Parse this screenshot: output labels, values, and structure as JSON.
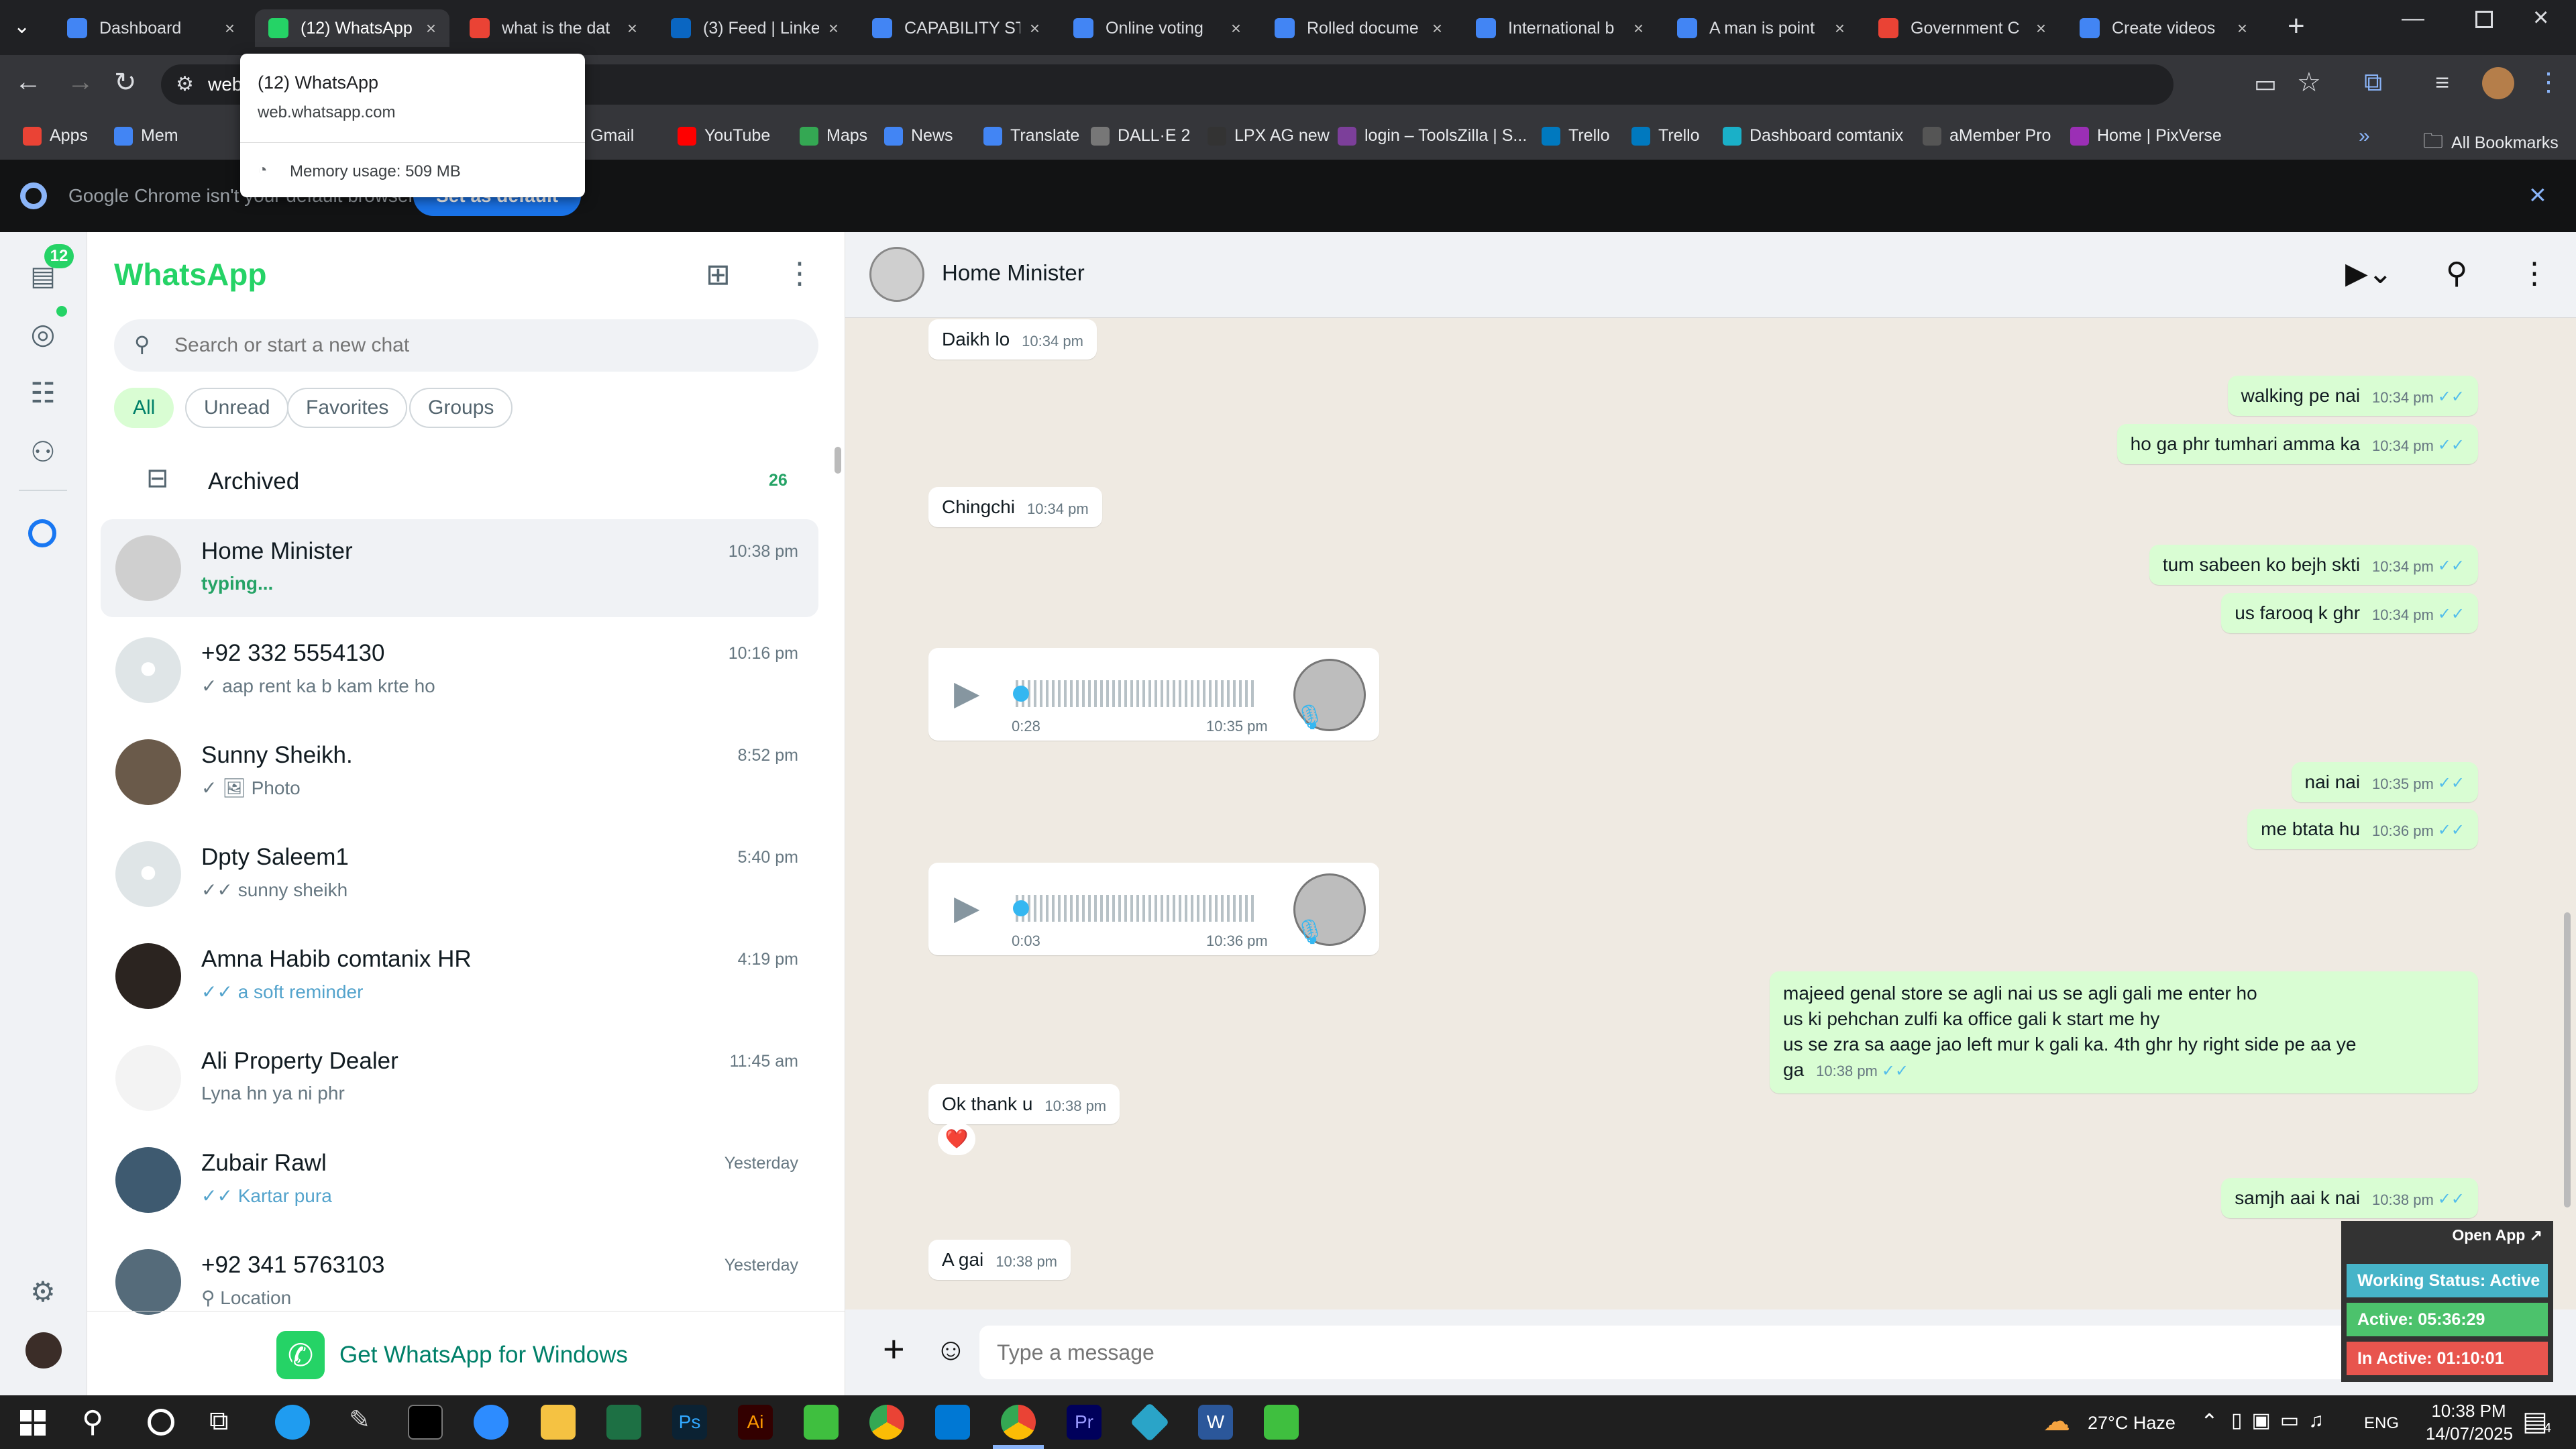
{
  "browser": {
    "tabs": [
      {
        "label": "Dashboard",
        "color": "#4285f4"
      },
      {
        "label": "(12) WhatsApp",
        "color": "#25d366",
        "active": true
      },
      {
        "label": "what is the dat",
        "color": "#ea4335"
      },
      {
        "label": "(3) Feed | Linke",
        "color": "#0a66c2"
      },
      {
        "label": "CAPABILITY ST",
        "color": "#4285f4"
      },
      {
        "label": "Online voting",
        "color": "#4285f4"
      },
      {
        "label": "Rolled docume",
        "color": "#4285f4"
      },
      {
        "label": "International b",
        "color": "#4285f4"
      },
      {
        "label": "A man is point",
        "color": "#4285f4"
      },
      {
        "label": "Government C",
        "color": "#ea4335"
      },
      {
        "label": "Create videos",
        "color": "#4285f4"
      }
    ],
    "address_text": "web",
    "bookmarks": [
      {
        "label": "Apps"
      },
      {
        "label": "Mem"
      },
      {
        "label": "Gmail"
      },
      {
        "label": "YouTube"
      },
      {
        "label": "Maps"
      },
      {
        "label": "News"
      },
      {
        "label": "Translate"
      },
      {
        "label": "DALL·E 2"
      },
      {
        "label": "LPX AG new"
      },
      {
        "label": "login – ToolsZilla | S..."
      },
      {
        "label": "Trello"
      },
      {
        "label": "Trello"
      },
      {
        "label": "Dashboard comtanix"
      },
      {
        "label": "aMember Pro"
      },
      {
        "label": "Home | PixVerse"
      }
    ],
    "all_bookmarks": "All Bookmarks",
    "infobar_text": "Google Chrome isn't your default browser",
    "infobar_button": "Set as default",
    "tooltip": {
      "title": "(12) WhatsApp",
      "url": "web.whatsapp.com",
      "memory": "Memory usage: 509 MB"
    }
  },
  "whatsapp": {
    "rail": {
      "unread_badge": "12"
    },
    "title": "WhatsApp",
    "search_placeholder": "Search or start a new chat",
    "filters": [
      "All",
      "Unread",
      "Favorites",
      "Groups"
    ],
    "archived": {
      "label": "Archived",
      "count": "26"
    },
    "chats": [
      {
        "name": "Home Minister",
        "time": "10:38 pm",
        "preview": "typing...",
        "typing": true
      },
      {
        "name": "+92 332 5554130",
        "time": "10:16 pm",
        "preview": "✓ aap rent ka b kam krte ho"
      },
      {
        "name": "Sunny Sheikh.",
        "time": "8:52 pm",
        "preview": "✓ 🖼 Photo"
      },
      {
        "name": "Dpty Saleem1",
        "time": "5:40 pm",
        "preview": "✓✓ sunny sheikh"
      },
      {
        "name": "Amna Habib comtanix HR",
        "time": "4:19 pm",
        "preview": "✓✓ a soft reminder",
        "blue": true
      },
      {
        "name": "Ali Property Dealer",
        "time": "11:45 am",
        "preview": "Lyna hn ya ni phr"
      },
      {
        "name": "Zubair Rawl",
        "time": "Yesterday",
        "preview": "✓✓ Kartar pura",
        "blue": true
      },
      {
        "name": "+92 341 5763103",
        "time": "Yesterday",
        "preview": "⚲ Location"
      }
    ],
    "get_app": "Get WhatsApp for Windows",
    "chat_header": {
      "name": "Home Minister"
    },
    "messages": {
      "m1": {
        "text": "Daikh lo",
        "time": "10:34 pm"
      },
      "m2": {
        "text": "walking pe nai",
        "time": "10:34 pm"
      },
      "m3": {
        "text": "ho ga phr tumhari amma ka",
        "time": "10:34 pm"
      },
      "m4": {
        "text": "Chingchi",
        "time": "10:34 pm"
      },
      "m5": {
        "text": "tum sabeen ko bejh skti",
        "time": "10:34 pm"
      },
      "m6": {
        "text": "us farooq k ghr",
        "time": "10:34 pm"
      },
      "v1": {
        "duration": "0:28",
        "time": "10:35 pm"
      },
      "m7": {
        "text": "nai nai",
        "time": "10:35 pm"
      },
      "m8": {
        "text": "me btata hu",
        "time": "10:36 pm"
      },
      "v2": {
        "duration": "0:03",
        "time": "10:36 pm"
      },
      "m9": {
        "line1": "majeed  genal store se agli nai us se agli gali me enter ho",
        "line2": "us ki pehchan zulfi ka office gali k start me hy",
        "line3": "us se zra sa aage jao left mur k gali ka. 4th ghr hy right side pe aa ye ga",
        "time": "10:38 pm"
      },
      "m10": {
        "text": "Ok thank u",
        "time": "10:38 pm",
        "reaction": "❤️"
      },
      "m11": {
        "text": "samjh aai k nai",
        "time": "10:38 pm"
      },
      "m12": {
        "text": "A gai",
        "time": "10:38 pm"
      }
    },
    "composer_placeholder": "Type a message"
  },
  "widget": {
    "open_app": "Open App ↗",
    "working_status": "Working Status: Active",
    "active": "Active: 05:36:29",
    "inactive": "In Active: 01:10:01"
  },
  "taskbar": {
    "weather": "27°C Haze",
    "lang": "ENG",
    "time": "10:38 PM",
    "date": "14/07/2025",
    "notif_count": "4"
  }
}
